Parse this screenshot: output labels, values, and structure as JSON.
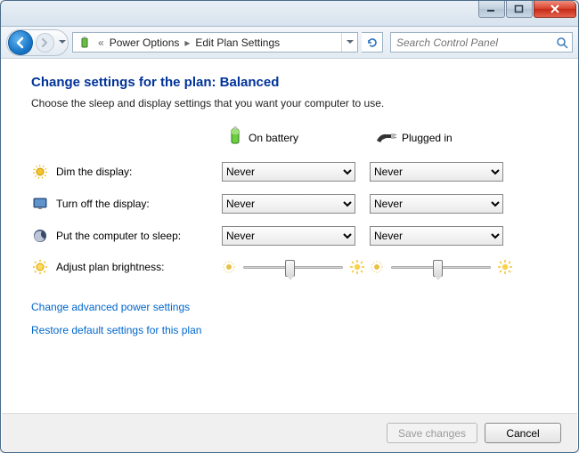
{
  "window": {
    "min_label": "Minimize",
    "max_label": "Maximize",
    "close_label": "Close"
  },
  "nav": {
    "back_label": "Back",
    "forward_label": "Forward",
    "breadcrumb": [
      "Power Options",
      "Edit Plan Settings"
    ],
    "refresh_label": "Refresh",
    "search_placeholder": "Search Control Panel"
  },
  "page": {
    "title": "Change settings for the plan: Balanced",
    "subtitle": "Choose the sleep and display settings that you want your computer to use."
  },
  "columns": {
    "battery": "On battery",
    "plugged": "Plugged in"
  },
  "rows": {
    "dim": {
      "label": "Dim the display:",
      "battery": "Never",
      "plugged": "Never"
    },
    "turnoff": {
      "label": "Turn off the display:",
      "battery": "Never",
      "plugged": "Never"
    },
    "sleep": {
      "label": "Put the computer to sleep:",
      "battery": "Never",
      "plugged": "Never"
    },
    "brightness": {
      "label": "Adjust plan brightness:"
    }
  },
  "links": {
    "advanced": "Change advanced power settings",
    "restore": "Restore default settings for this plan"
  },
  "footer": {
    "save": "Save changes",
    "cancel": "Cancel"
  },
  "colors": {
    "link": "#0066cc",
    "title": "#003399"
  }
}
